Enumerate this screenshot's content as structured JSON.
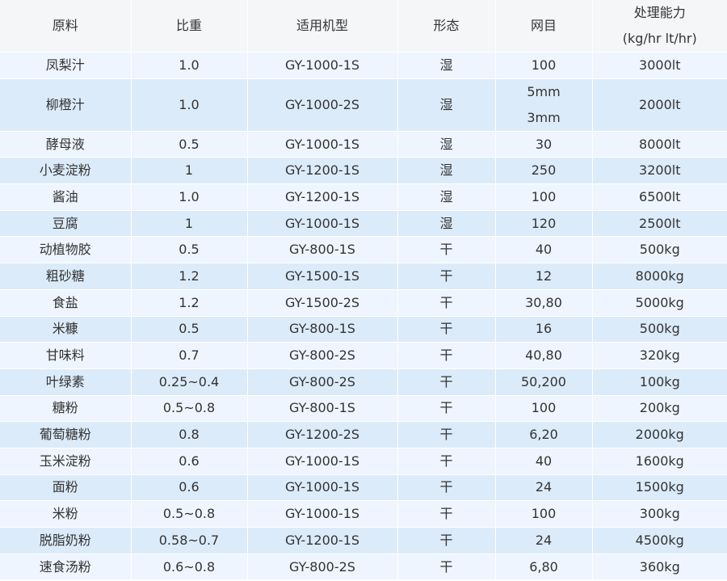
{
  "table": {
    "headers": {
      "material": "原料",
      "density": "比重",
      "model": "适用机型",
      "form": "形态",
      "mesh": "网目",
      "capacity_line1": "处理能力",
      "capacity_line2": "(kg/hr lt/hr)"
    },
    "rows": [
      {
        "material": "凤梨汁",
        "density": "1.0",
        "model": "GY-1000-1S",
        "form": "湿",
        "mesh": "100",
        "capacity": "3000lt"
      },
      {
        "material": "柳橙汁",
        "density": "1.0",
        "model": "GY-1000-2S",
        "form": "湿",
        "mesh": "5mm",
        "mesh2": "3mm",
        "capacity": "2000lt"
      },
      {
        "material": "酵母液",
        "density": "0.5",
        "model": "GY-1000-1S",
        "form": "湿",
        "mesh": "30",
        "capacity": "8000lt"
      },
      {
        "material": "小麦淀粉",
        "density": "1",
        "model": "GY-1200-1S",
        "form": "湿",
        "mesh": "250",
        "capacity": "3200lt"
      },
      {
        "material": "酱油",
        "density": "1.0",
        "model": "GY-1200-1S",
        "form": "湿",
        "mesh": "100",
        "capacity": "6500lt"
      },
      {
        "material": "豆腐",
        "density": "1",
        "model": "GY-1000-1S",
        "form": "湿",
        "mesh": "120",
        "capacity": "2500lt"
      },
      {
        "material": "动植物胶",
        "density": "0.5",
        "model": "GY-800-1S",
        "form": "干",
        "mesh": "40",
        "capacity": "500kg"
      },
      {
        "material": "粗砂糖",
        "density": "1.2",
        "model": "GY-1500-1S",
        "form": "干",
        "mesh": "12",
        "capacity": "8000kg"
      },
      {
        "material": "食盐",
        "density": "1.2",
        "model": "GY-1500-2S",
        "form": "干",
        "mesh": "30,80",
        "capacity": "5000kg"
      },
      {
        "material": "米糠",
        "density": "0.5",
        "model": "GY-800-1S",
        "form": "干",
        "mesh": "16",
        "capacity": "500kg"
      },
      {
        "material": "甘味料",
        "density": "0.7",
        "model": "GY-800-2S",
        "form": "干",
        "mesh": "40,80",
        "capacity": "320kg"
      },
      {
        "material": "叶绿素",
        "density": "0.25~0.4",
        "model": "GY-800-2S",
        "form": "干",
        "mesh": "50,200",
        "capacity": "100kg"
      },
      {
        "material": "糖粉",
        "density": "0.5~0.8",
        "model": "GY-800-1S",
        "form": "干",
        "mesh": "100",
        "capacity": "200kg"
      },
      {
        "material": "葡萄糖粉",
        "density": "0.8",
        "model": "GY-1200-2S",
        "form": "干",
        "mesh": "6,20",
        "capacity": "2000kg"
      },
      {
        "material": "玉米淀粉",
        "density": "0.6",
        "model": "GY-1000-1S",
        "form": "干",
        "mesh": "40",
        "capacity": "1600kg"
      },
      {
        "material": "面粉",
        "density": "0.6",
        "model": "GY-1000-1S",
        "form": "干",
        "mesh": "24",
        "capacity": "1500kg"
      },
      {
        "material": "米粉",
        "density": "0.5~0.8",
        "model": "GY-1000-1S",
        "form": "干",
        "mesh": "100",
        "capacity": "300kg"
      },
      {
        "material": "脱脂奶粉",
        "density": "0.58~0.7",
        "model": "GY-1200-1S",
        "form": "干",
        "mesh": "24",
        "capacity": "4500kg"
      },
      {
        "material": "速食汤粉",
        "density": "0.6~0.8",
        "model": "GY-800-2S",
        "form": "干",
        "mesh": "6,80",
        "capacity": "360kg"
      }
    ]
  }
}
